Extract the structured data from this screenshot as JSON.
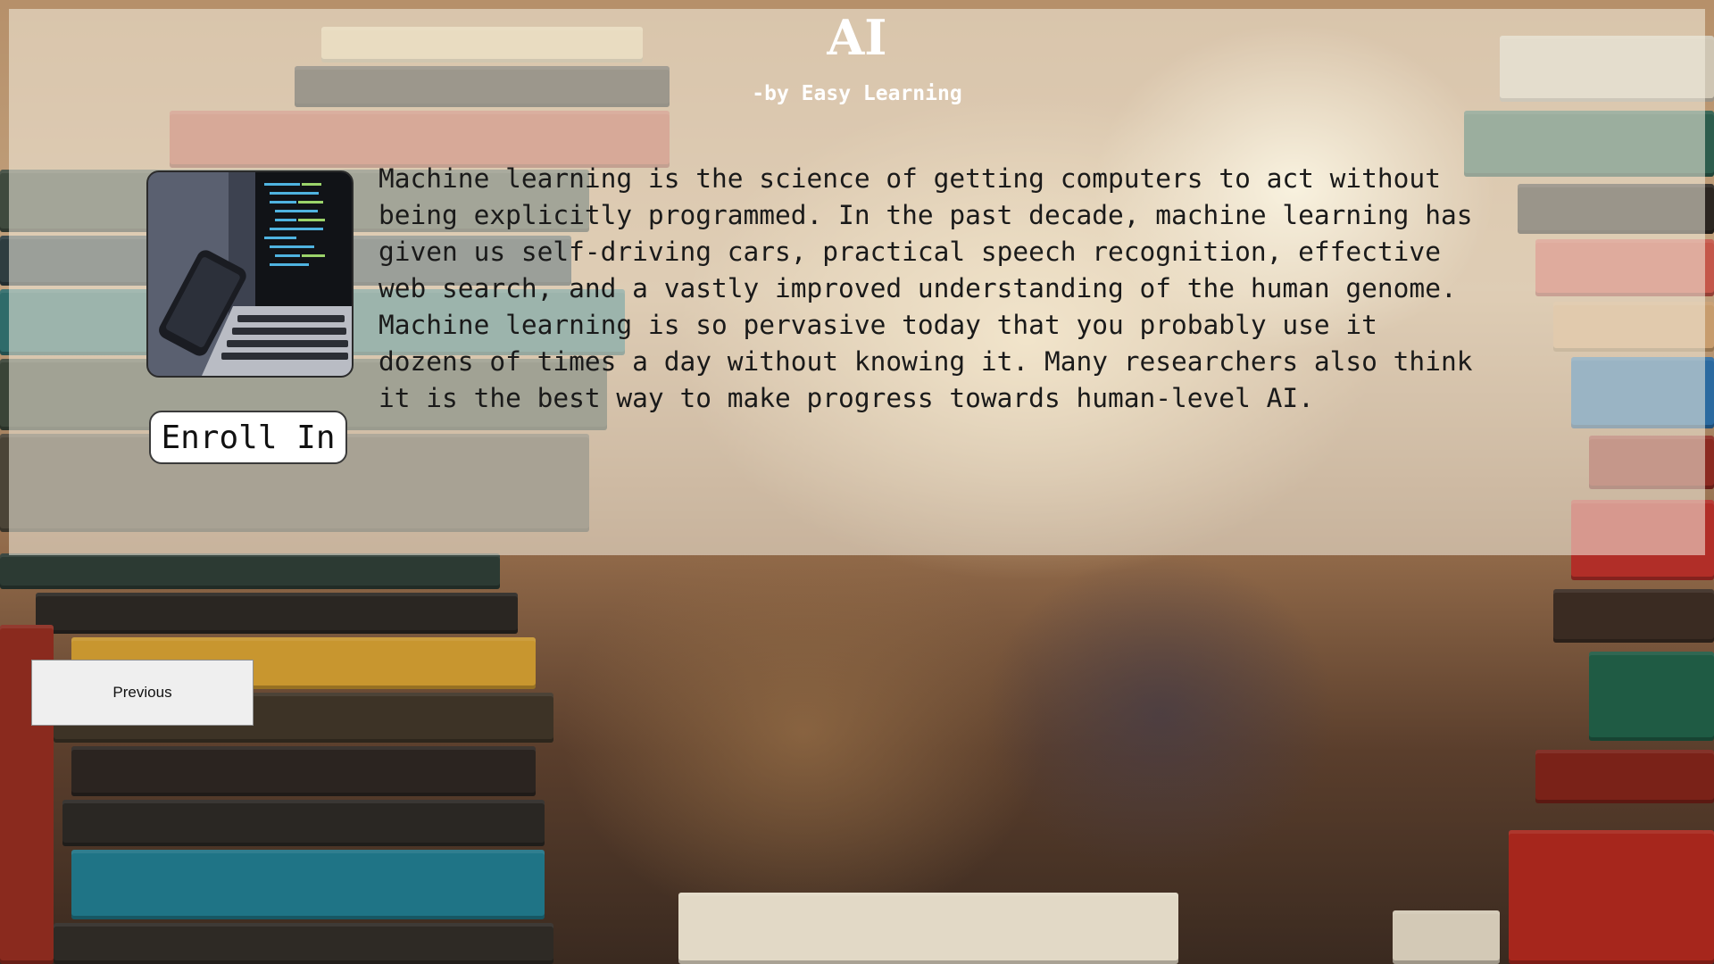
{
  "header": {
    "title": "AI",
    "byline": "-by Easy Learning"
  },
  "course": {
    "image_icon": "laptop-code-photo",
    "enroll_label": "Enroll In",
    "description": "Machine learning is the science of getting computers to act without being explicitly programmed. In the past decade, machine learning has given us self-driving cars, practical speech recognition, effective web search, and a vastly improved understanding of the human genome. Machine learning is so pervasive today that you probably use it dozens of times a day without knowing it. Many researchers also think it is the best way to make progress towards human-level AI."
  },
  "nav": {
    "previous_label": "Previous"
  },
  "background": {
    "image": "library-bookshelves-photo"
  }
}
